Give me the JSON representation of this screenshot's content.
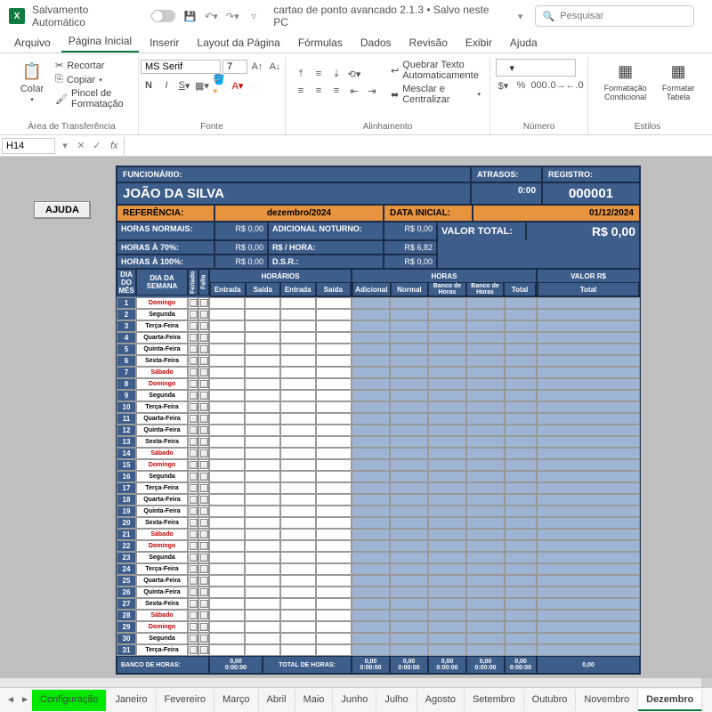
{
  "titlebar": {
    "autosave": "Salvamento Automático",
    "doc": "cartao de ponto avancado 2.1.3 • Salvo neste PC",
    "search_placeholder": "Pesquisar"
  },
  "menus": [
    "Arquivo",
    "Página Inicial",
    "Inserir",
    "Layout da Página",
    "Fórmulas",
    "Dados",
    "Revisão",
    "Exibir",
    "Ajuda"
  ],
  "ribbon": {
    "paste": "Colar",
    "cut": "Recortar",
    "copy": "Copiar",
    "format_painter": "Pincel de Formatação",
    "clipboard_group": "Área de Transferência",
    "font_name": "MS Serif",
    "font_size": "7",
    "font_group": "Fonte",
    "wrap": "Quebrar Texto Automaticamente",
    "merge": "Mesclar e Centralizar",
    "align_group": "Alinhamento",
    "number_group": "Número",
    "cond_fmt": "Formatação Condicional",
    "fmt_table": "Formatar Tabela",
    "styles_group": "Estilos"
  },
  "formula": {
    "cell": "H14"
  },
  "ajuda": "AJUDA",
  "header": {
    "func_lbl": "FUNCIONÁRIO:",
    "func": "JOÃO DA SILVA",
    "atrasos_lbl": "ATRASOS:",
    "atrasos": "0:00",
    "registro_lbl": "REGISTRO:",
    "registro": "000001",
    "ref_lbl": "REFERÊNCIA:",
    "ref": "dezembro/2024",
    "data_lbl": "DATA INICIAL:",
    "data": "01/12/2024",
    "hn": "HORAS NORMAIS:",
    "h70": "HORAS À 70%:",
    "h100": "HORAS À 100%:",
    "adn": "ADICIONAL NOTURNO:",
    "rsh": "R$ / HORA:",
    "dsr": "D.S.R.:",
    "rs0": "R$ 0,00",
    "rs682": "R$ 6,82",
    "valor_lbl": "VALOR TOTAL:",
    "valor": "R$ 0,00"
  },
  "cols": {
    "dia": "DIA DO MÊS",
    "sem": "DIA DA SEMANA",
    "fer": "Feriado",
    "fal": "Falta",
    "horarios": "HORÁRIOS",
    "horas": "HORAS",
    "valor": "VALOR R$",
    "ent": "Entrada",
    "sai": "Saída",
    "adic": "Adicional",
    "norm": "Normal",
    "bdh": "Banco de Horas",
    "bdh2": "Banco de Horas",
    "tot": "Total"
  },
  "days": [
    {
      "n": "1",
      "d": "Domingo",
      "red": true
    },
    {
      "n": "2",
      "d": "Segunda"
    },
    {
      "n": "3",
      "d": "Terça-Feira"
    },
    {
      "n": "4",
      "d": "Quarta-Feira"
    },
    {
      "n": "5",
      "d": "Quinta-Feira"
    },
    {
      "n": "6",
      "d": "Sexta-Feira"
    },
    {
      "n": "7",
      "d": "Sábado",
      "red": true
    },
    {
      "n": "8",
      "d": "Domingo",
      "red": true
    },
    {
      "n": "9",
      "d": "Segunda"
    },
    {
      "n": "10",
      "d": "Terça-Feira"
    },
    {
      "n": "11",
      "d": "Quarta-Feira"
    },
    {
      "n": "12",
      "d": "Quinta-Feira"
    },
    {
      "n": "13",
      "d": "Sexta-Feira"
    },
    {
      "n": "14",
      "d": "Sábado",
      "red": true
    },
    {
      "n": "15",
      "d": "Domingo",
      "red": true
    },
    {
      "n": "16",
      "d": "Segunda"
    },
    {
      "n": "17",
      "d": "Terça-Feira"
    },
    {
      "n": "18",
      "d": "Quarta-Feira"
    },
    {
      "n": "19",
      "d": "Quinta-Feira"
    },
    {
      "n": "20",
      "d": "Sexta-Feira"
    },
    {
      "n": "21",
      "d": "Sábado",
      "red": true
    },
    {
      "n": "22",
      "d": "Domingo",
      "red": true
    },
    {
      "n": "23",
      "d": "Segunda"
    },
    {
      "n": "24",
      "d": "Terça-Feira"
    },
    {
      "n": "25",
      "d": "Quarta-Feira"
    },
    {
      "n": "26",
      "d": "Quinta-Feira"
    },
    {
      "n": "27",
      "d": "Sexta-Feira"
    },
    {
      "n": "28",
      "d": "Sábado",
      "red": true
    },
    {
      "n": "29",
      "d": "Domingo",
      "red": true
    },
    {
      "n": "30",
      "d": "Segunda"
    },
    {
      "n": "31",
      "d": "Terça-Feira"
    }
  ],
  "footer": {
    "bdh": "BANCO DE HORAS:",
    "total": "TOTAL DE HORAS:",
    "zero": "0,00",
    "zeroh": "0:00:00"
  },
  "tabs": [
    "Configuração",
    "Janeiro",
    "Fevereiro",
    "Março",
    "Abril",
    "Maio",
    "Junho",
    "Julho",
    "Agosto",
    "Setembro",
    "Outubro",
    "Novembro",
    "Dezembro"
  ]
}
